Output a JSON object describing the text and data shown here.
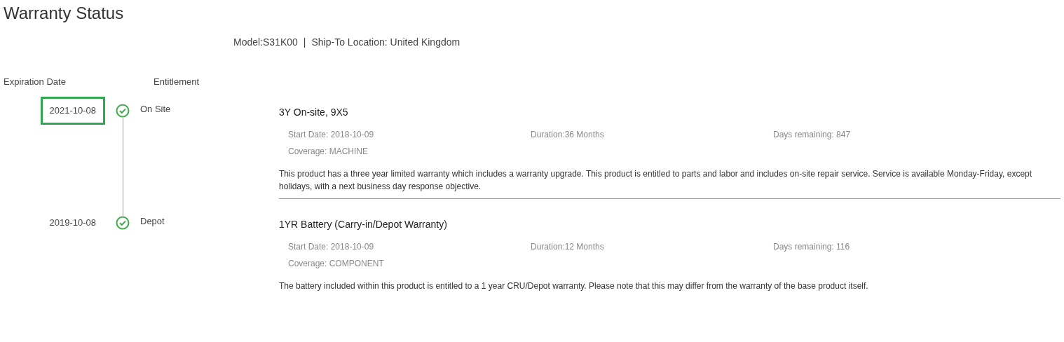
{
  "title": "Warranty Status",
  "product_info": {
    "model": "Model:S31K00",
    "separator": "|",
    "location": "Ship-To Location: United Kingdom"
  },
  "columns": [
    "Expiration Date",
    "Entitlement"
  ],
  "entries": [
    {
      "expiration_date": "2021-10-08",
      "highlighted": true,
      "active": true,
      "entitlement": "On Site",
      "service_name": "3Y On-site, 9X5",
      "start_date": "Start Date: 2018-10-09",
      "duration": "Duration:36 Months",
      "days_remaining": "Days remaining: 847",
      "coverage": "Coverage: MACHINE",
      "description": "This product has a three year limited warranty which includes a warranty upgrade. This product is entitled to parts and labor and includes on-site repair service. Service is available Monday-Friday, except holidays, with a next business day response objective."
    },
    {
      "expiration_date": "2019-10-08",
      "highlighted": false,
      "active": true,
      "entitlement": "Depot",
      "service_name": "1YR Battery (Carry-in/Depot Warranty)",
      "start_date": "Start Date: 2018-10-09",
      "duration": "Duration:12 Months",
      "days_remaining": "Days remaining: 116",
      "coverage": "Coverage: COMPONENT",
      "description": "The battery included within this product is entitled to a 1 year CRU/Depot warranty. Please note that this may differ from the warranty of the base product itself."
    }
  ]
}
